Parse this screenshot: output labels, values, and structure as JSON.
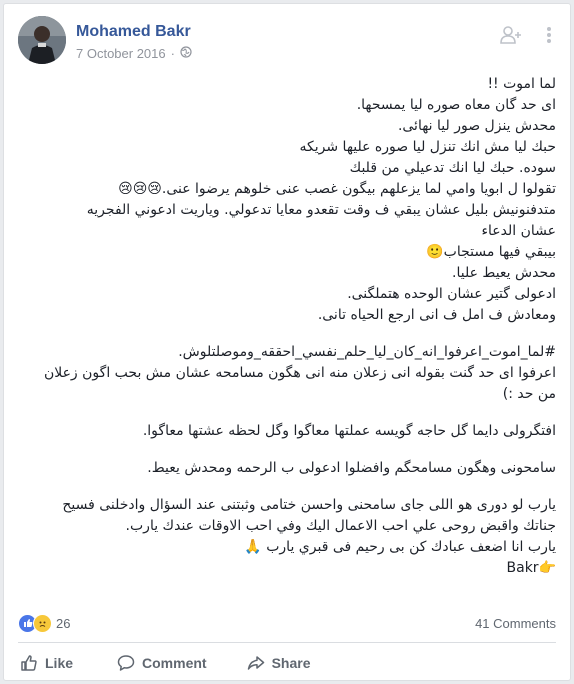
{
  "post": {
    "author": "Mohamed Bakr",
    "date": "7 October 2016",
    "separator": "·",
    "lines_a": [
      "لما اموت !!",
      "اى حد گان معاه صوره ليا يمسحها.",
      "محدش ينزل صور ليا نهائى.",
      "حبك ليا مش انك تنزل ليا صوره عليها شريكه",
      "سوده. حبك ليا انك تدعيلي من قلبك",
      "تقولوا ل ابويا وامي لما يزعلهم بيگون غصب عنى خلوهم يرضوا عنى.😢😢😢",
      "متدفنونيش بليل عشان يبقي ف وقت تقعدو معايا تدعولي. وياريت ادعوني الفجريه",
      "عشان الدعاء",
      "بيبقي فيها مستجاب🙂",
      "محدش يعيط عليا.",
      "ادعولى گتير عشان الوحده هتملگنى.",
      "ومعادش ف امل ف انى ارجع الحياه تانى."
    ],
    "lines_b": [
      "#لما_اموت_اعرفوا_انه_كان_ليا_حلم_نفسي_احققه_وموصلتلوش.",
      "اعرفوا اى حد گنت بقوله انى زعلان منه انى هگون مسامحه عشان مش بحب اگون زعلان",
      "من حد :)"
    ],
    "line_c": "افتگرولى دايما گل حاجه گويسه عملتها معاگوا وگل لحظه عشتها معاگوا.",
    "line_d": "سامحونى وهگون مسامحگم وافضلوا ادعولى ب الرحمه ومحدش يعيط.",
    "lines_e": [
      "يارب لو دورى هو اللى جاى سامحنى واحسن ختامى وثبتنى عند السؤال وادخلنى فسيح",
      "جناتك واقبض روحى علي احب الاعمال اليك وفي احب الاوقات عندك يارب.",
      "يارب انا اضعف عبادك كن بى رحيم فى قبري يارب 🙏",
      "👉Bakr"
    ]
  },
  "footer": {
    "reaction_count": "26",
    "comments": "41 Comments",
    "like_label": "Like",
    "comment_label": "Comment",
    "share_label": "Share"
  },
  "icons": {
    "globe": "globe-icon",
    "add_friend": "add-friend-icon",
    "more": "more-options-icon",
    "like_reaction": "like-reaction-icon",
    "sad_reaction": "sad-reaction-icon"
  },
  "colors": {
    "author": "#365899",
    "meta": "#90949c",
    "text": "#1d2129",
    "actions": "#606770",
    "like_blue": "#4a76e8"
  }
}
